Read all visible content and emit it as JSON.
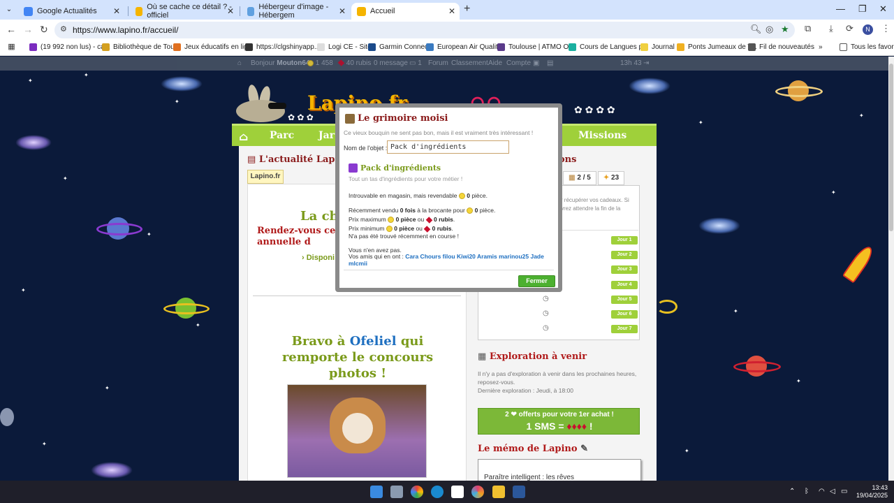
{
  "browser": {
    "tabs": [
      {
        "title": "Google Actualités",
        "favicon_color": "#4285f4"
      },
      {
        "title": "Où se cache ce détail ? - officiel",
        "favicon_color": "#f5b400"
      },
      {
        "title": "Hébergeur d'image - Hébergem",
        "favicon_color": "#60a0e0"
      },
      {
        "title": "Accueil",
        "favicon_color": "#f5b400"
      }
    ],
    "url": "https://www.lapino.fr/accueil/",
    "profile_initial": "N",
    "bookmarks": [
      {
        "label": "(19 992 non lus) - ca...",
        "color": "#7b2cbf"
      },
      {
        "label": "Bibliothèque de Tou...",
        "color": "#d4a020"
      },
      {
        "label": "Jeux éducatifs en lig...",
        "color": "#e07020"
      },
      {
        "label": "https://clgshinyapp...",
        "color": "#333333"
      },
      {
        "label": "Logi CE - Site",
        "color": "#dddddd"
      },
      {
        "label": "Garmin Connect",
        "color": "#1a4a8a"
      },
      {
        "label": "European Air Qualit...",
        "color": "#3a7ac0"
      },
      {
        "label": "Toulouse | ATMO O...",
        "color": "#5a3a8a"
      },
      {
        "label": "Cours de Langues p...",
        "color": "#1ab0a0"
      },
      {
        "label": "Journal",
        "color": "#f0d040"
      },
      {
        "label": "Ponts Jumeaux de T...",
        "color": "#f0b020"
      },
      {
        "label": "Fil de nouveautés",
        "color": "#555555"
      }
    ],
    "all_bookmarks": "Tous les favoris"
  },
  "sitebar": {
    "greeting": "Bonjour",
    "username": "Mouton64",
    "coins": "1 458",
    "rubis": "40 rubis",
    "messages": "0 message",
    "notif_count": "1",
    "forum": "Forum",
    "classement": "Classement",
    "aide": "Aide",
    "compte": "Compte",
    "time": "13h 43"
  },
  "site": {
    "logo": "Lapino.fr",
    "menu": [
      "Parc",
      "Jar",
      "Missions"
    ],
    "news_title": "L'actualité Lapino",
    "news_tab": "Lapino.fr",
    "news_headline": "La chas",
    "news_rdv": "Rendez-vous ce dim\nannuelle d",
    "news_dispo": "› Disponi",
    "bravo_prefix": "Bravo à ",
    "bravo_name": "Ofeliel",
    "bravo_suffix": " qui remporte le concours photos !",
    "missions_title": "ons",
    "tab_calendar": "2 / 5",
    "tab_count": "23",
    "gift_text": "our récupérer vos cadeaux. Si devrez attendre la fin de la",
    "jours": [
      "Jour 1",
      "Jour 2",
      "Jour 3",
      "Jour 4",
      "Jour 5",
      "Jour 6",
      "Jour 7"
    ],
    "explo_title": "Exploration à venir",
    "explo_text": "Il n'y a pas d'exploration à venir dans les prochaines heures, reposez-vous.",
    "explo_last": "Dernière exploration : Jeudi, à 18:00",
    "sms_line1": "2 ❤ offerts pour votre 1er achat !",
    "sms_line2": "1 SMS =",
    "memo_title": "Le mémo de Lapino",
    "memo_text": "Paraître intelligent : les rêves"
  },
  "modal": {
    "title": "Le grimoire moisi",
    "subtitle": "Ce vieux bouquin ne sent pas bon, mais il est vraiment très intéressant !",
    "field_label": "Nom de l'objet :",
    "field_value": "Pack d'ingrédients",
    "product_title": "Pack d'ingrédients",
    "product_desc": "Tout un tas d'ingrédients pour votre métier !",
    "line_store": "Introuvable en magasin, mais revendable",
    "line_store_value": "0",
    "line_store_unit": "pièce.",
    "sold_prefix": "Récemment vendu",
    "sold_value": "0 fois",
    "sold_mid": "à la brocante pour",
    "sold_price": "0",
    "sold_unit": "pièce.",
    "max_label": "Prix maximum",
    "max_coins": "0 pièce",
    "max_or": "ou",
    "max_rubis": "0 rubis",
    "min_label": "Prix minimum",
    "min_coins": "0 pièce",
    "min_or": "ou",
    "min_rubis": "0 rubis",
    "not_found": "N'a pas été trouvé récemment en course !",
    "not_have": "Vous n'en avez pas.",
    "friends_label": "Vos amis qui en ont :",
    "friends": "Cara Chours filou Kiwi20 Aramis marinou25 Jade mlcmii",
    "close_label": "Fermer"
  },
  "taskbar": {
    "time": "13:43",
    "date": "19/04/2025"
  }
}
